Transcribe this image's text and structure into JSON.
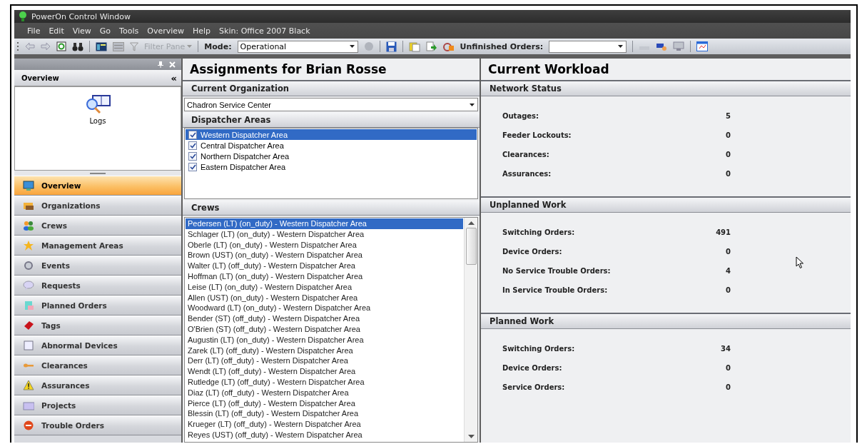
{
  "window": {
    "title": "PowerOn Control Window"
  },
  "menu": [
    {
      "label": "File"
    },
    {
      "label": "Edit"
    },
    {
      "label": "View"
    },
    {
      "label": "Go"
    },
    {
      "label": "Tools"
    },
    {
      "label": "Overview"
    },
    {
      "label": "Help"
    },
    {
      "label": "Skin: Office 2007 Black"
    }
  ],
  "toolbar": {
    "filter_pane": "Filter Pane",
    "mode_label": "Mode:",
    "mode_value": "Operational",
    "unfinished_label": "Unfinished Orders:"
  },
  "sidebar": {
    "header": "Overview",
    "collapse": "«",
    "shortcuts": [
      {
        "label": "Logs"
      }
    ],
    "items": [
      {
        "label": "Overview",
        "selected": true
      },
      {
        "label": "Organizations",
        "selected": false
      },
      {
        "label": "Crews",
        "selected": false
      },
      {
        "label": "Management Areas",
        "selected": false
      },
      {
        "label": "Events",
        "selected": false
      },
      {
        "label": "Requests",
        "selected": false
      },
      {
        "label": "Planned Orders",
        "selected": false
      },
      {
        "label": "Tags",
        "selected": false
      },
      {
        "label": "Abnormal Devices",
        "selected": false
      },
      {
        "label": "Clearances",
        "selected": false
      },
      {
        "label": "Assurances",
        "selected": false
      },
      {
        "label": "Projects",
        "selected": false
      },
      {
        "label": "Trouble Orders",
        "selected": false
      }
    ]
  },
  "assignments": {
    "title": "Assignments for  Brian Rosse",
    "organization_header": "Current Organization",
    "organization": "Chadron Service Center",
    "areas_header": "Dispatcher Areas",
    "areas": [
      {
        "label": "Western Dispatcher Area",
        "checked": true,
        "selected": true
      },
      {
        "label": "Central Dispatcher Area",
        "checked": true,
        "selected": false
      },
      {
        "label": "Northern Dispatcher Area",
        "checked": true,
        "selected": false
      },
      {
        "label": "Eastern Dispatcher Area",
        "checked": true,
        "selected": false
      }
    ],
    "crews_header": "Crews",
    "crews": [
      {
        "label": "Pedersen (LT) (on_duty) - Western Dispatcher Area",
        "selected": true
      },
      {
        "label": "Schlager (LT) (on_duty) - Western Dispatcher Area",
        "selected": false
      },
      {
        "label": "Oberle (LT) (on_duty) - Western Dispatcher Area",
        "selected": false
      },
      {
        "label": "Brown (UST) (on_duty) - Western Dispatcher Area",
        "selected": false
      },
      {
        "label": "Walter (LT) (off_duty) - Western Dispatcher Area",
        "selected": false
      },
      {
        "label": "Hoffman (LT) (on_duty) - Western Dispatcher Area",
        "selected": false
      },
      {
        "label": "Leise (LT) (on_duty) - Western Dispatcher Area",
        "selected": false
      },
      {
        "label": "Allen (UST) (on_duty) - Western Dispatcher Area",
        "selected": false
      },
      {
        "label": "Woodward (LT) (on_duty) - Western Dispatcher Area",
        "selected": false
      },
      {
        "label": "Bender (ST) (off_duty) - Western Dispatcher Area",
        "selected": false
      },
      {
        "label": "O'Brien (ST) (off_duty) - Western Dispatcher Area",
        "selected": false
      },
      {
        "label": "Augustin (LT) (on_duty) - Western Dispatcher Area",
        "selected": false
      },
      {
        "label": "Zarek (LT) (off_duty) - Western Dispatcher Area",
        "selected": false
      },
      {
        "label": "Derr (LT) (off_duty) - Western Dispatcher Area",
        "selected": false
      },
      {
        "label": "Wendt (LT) (off_duty) - Western Dispatcher Area",
        "selected": false
      },
      {
        "label": "Rutledge (LT) (off_duty) - Western Dispatcher Area",
        "selected": false
      },
      {
        "label": "Diaz (LT) (off_duty) - Western Dispatcher Area",
        "selected": false
      },
      {
        "label": "Pierce (LT) (off_duty) - Western Dispatcher Area",
        "selected": false
      },
      {
        "label": "Blessin (LT) (off_duty) - Western Dispatcher Area",
        "selected": false
      },
      {
        "label": "Krueger (LT) (off_duty) - Western Dispatcher Area",
        "selected": false
      },
      {
        "label": "Reyes (UST) (off_duty) - Western Dispatcher Area",
        "selected": false
      }
    ]
  },
  "workload": {
    "title": "Current Workload",
    "sections": [
      {
        "header": "Network Status",
        "rows": [
          {
            "label": "Outages:",
            "value": "5"
          },
          {
            "label": "Feeder Lockouts:",
            "value": "0"
          },
          {
            "label": "Clearances:",
            "value": "0"
          },
          {
            "label": "Assurances:",
            "value": "0"
          }
        ]
      },
      {
        "header": "Unplanned Work",
        "rows": [
          {
            "label": "Switching Orders:",
            "value": "491"
          },
          {
            "label": "Device Orders:",
            "value": "0"
          },
          {
            "label": "No Service Trouble Orders:",
            "value": "4"
          },
          {
            "label": "In Service Trouble Orders:",
            "value": "0"
          }
        ]
      },
      {
        "header": "Planned Work",
        "rows": [
          {
            "label": "Switching Orders:",
            "value": "34"
          },
          {
            "label": "Device Orders:",
            "value": "0"
          },
          {
            "label": "Service Orders:",
            "value": "0"
          }
        ]
      }
    ]
  }
}
